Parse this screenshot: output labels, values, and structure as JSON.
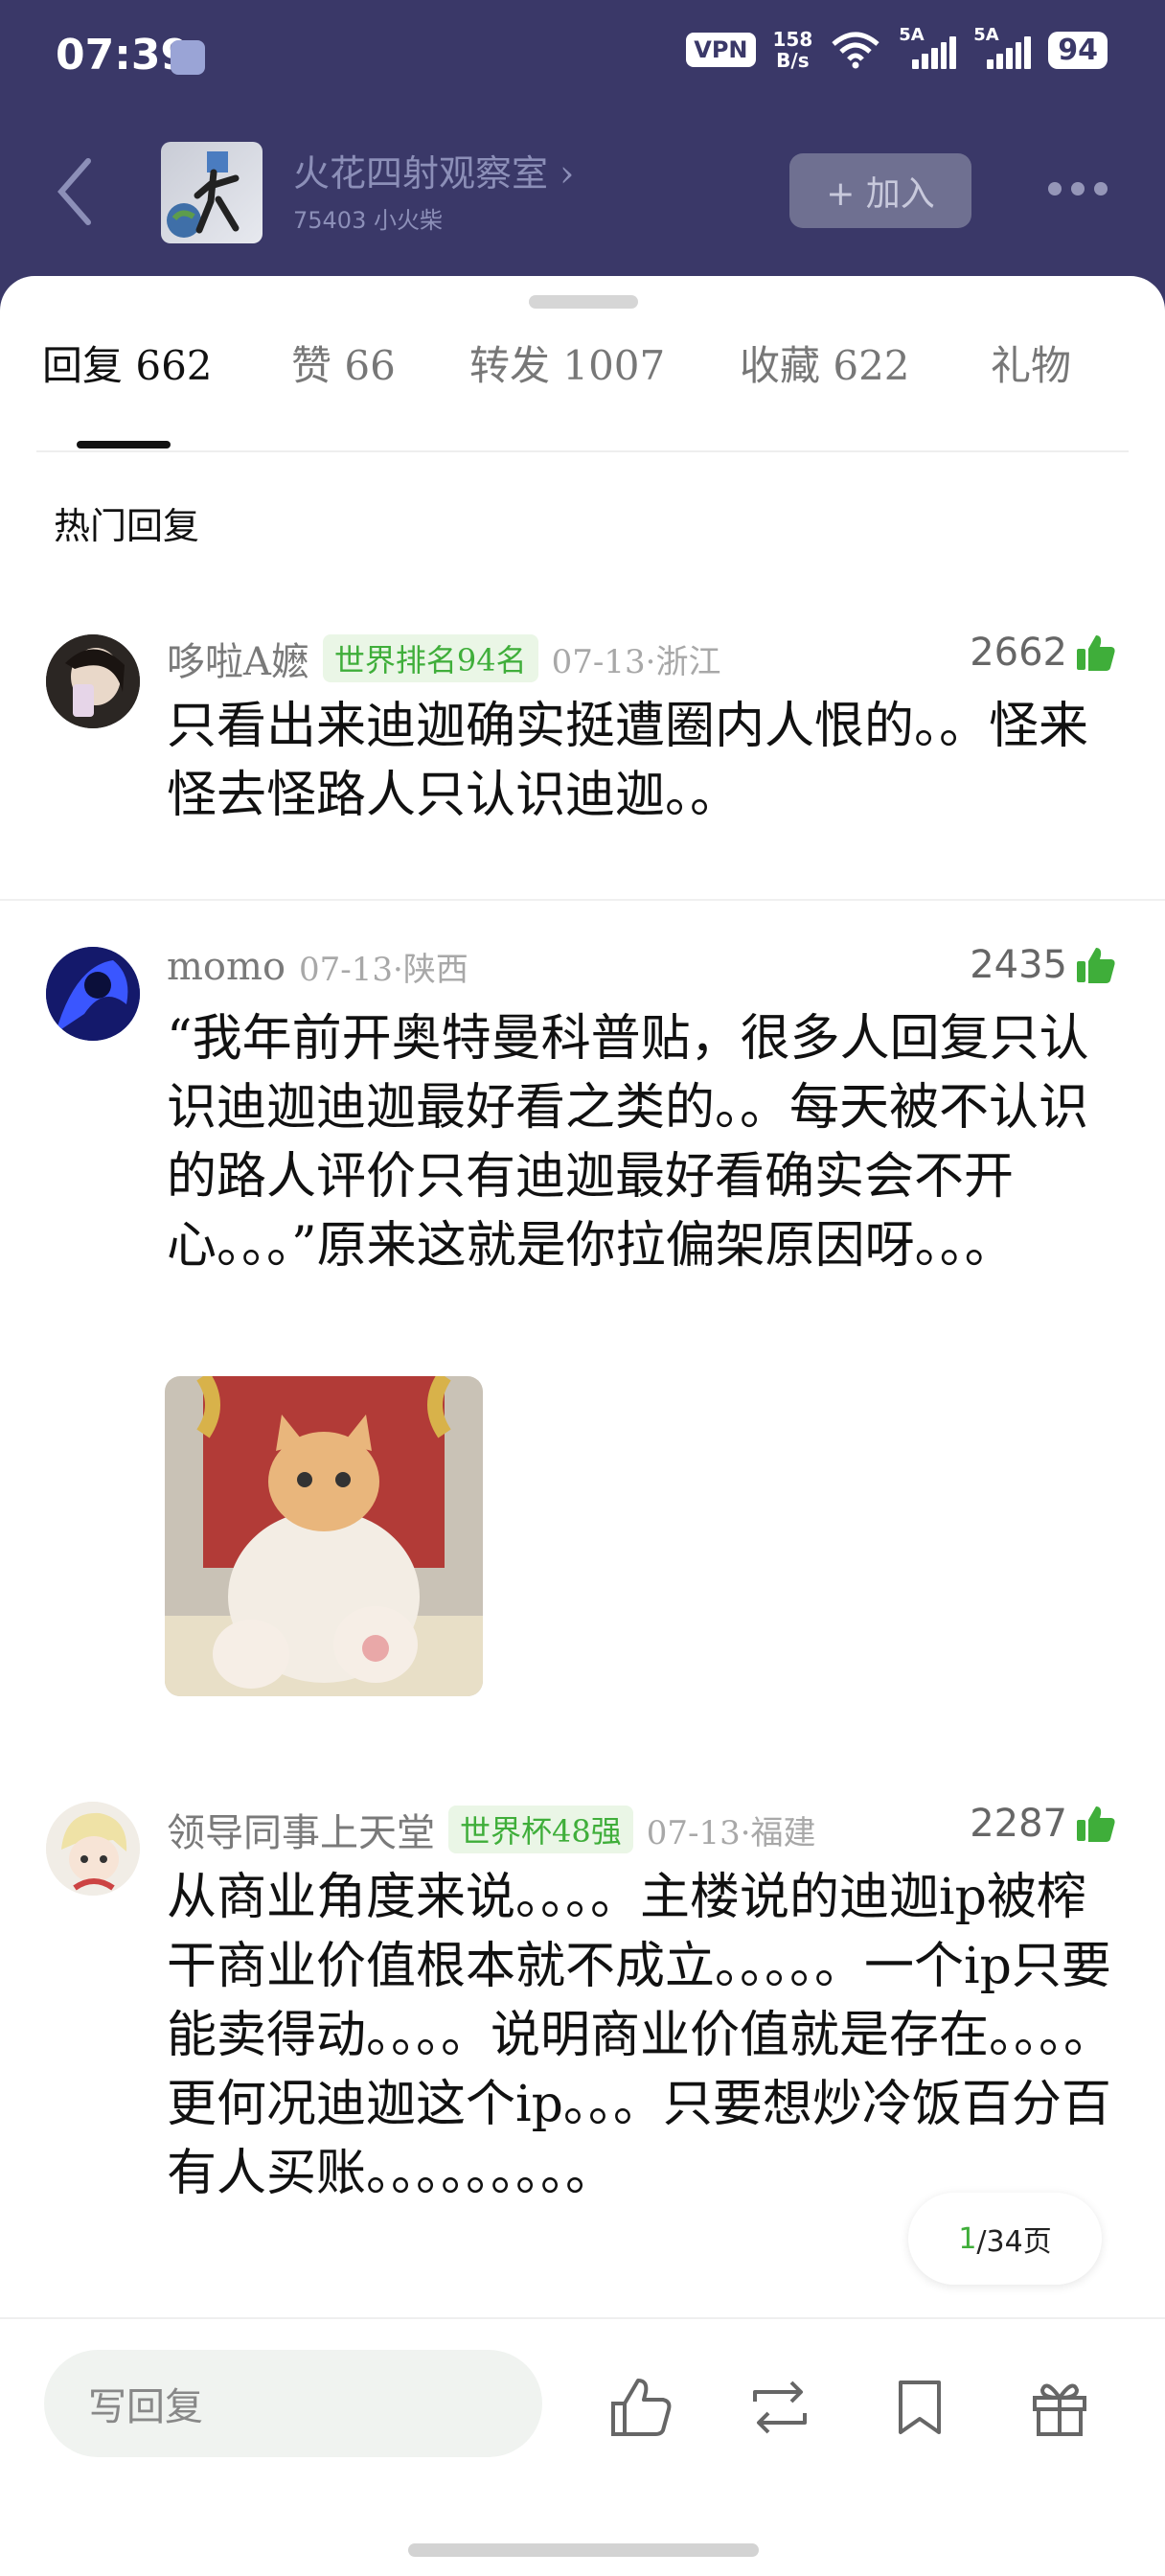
{
  "status_bar": {
    "time": "07:39",
    "vpn": "VPN",
    "speed_value": "158",
    "speed_unit": "B/s",
    "signal1_label": "5A",
    "signal2_label": "5A",
    "battery": "94"
  },
  "header": {
    "group_name": "火花四射观察室 ›",
    "group_sub": "75403 小火柴",
    "join_label": "+ 加入"
  },
  "tabs": [
    {
      "label": "回复 662"
    },
    {
      "label": "赞 66"
    },
    {
      "label": "转发 1007"
    },
    {
      "label": "收藏 622"
    },
    {
      "label": "礼物"
    }
  ],
  "section_title": "热门回复",
  "comments": [
    {
      "username": "哆啦A嬷",
      "badge": "世界排名94名",
      "date_location": "07-13·浙江",
      "likes": "2662",
      "body": "只看出来迪迦确实挺遭圈内人恨的。。怪来怪去怪路人只认识迪迦。。"
    },
    {
      "username": "momo",
      "badge": "",
      "date_location": "07-13·陕西",
      "likes": "2435",
      "body": "“我年前开奥特曼科普贴，很多人回复只认识迪迦迪迦最好看之类的。。每天被不认识的路人评价只有迪迦最好看确实会不开心。。。”原来这就是你拉偏架原因呀。。。"
    },
    {
      "username": "领导同事上天堂",
      "badge": "世界杯48强",
      "date_location": "07-13·福建",
      "likes": "2287",
      "body": "从商业角度来说。。。。主楼说的迪迦ip被榨干商业价值根本就不成立。。。。。一个ip只要能卖得动。。。。说明商业价值就是存在。。。。更何况迪迦这个ip。。。只要想炒冷饭百分百有人买账。。。。。。。。。"
    }
  ],
  "pager": {
    "current": "1",
    "total": "/34页"
  },
  "bottom_bar": {
    "reply_placeholder": "写回复"
  },
  "colors": {
    "header_bg": "#3a3868",
    "accent_green": "#3fae3a"
  }
}
